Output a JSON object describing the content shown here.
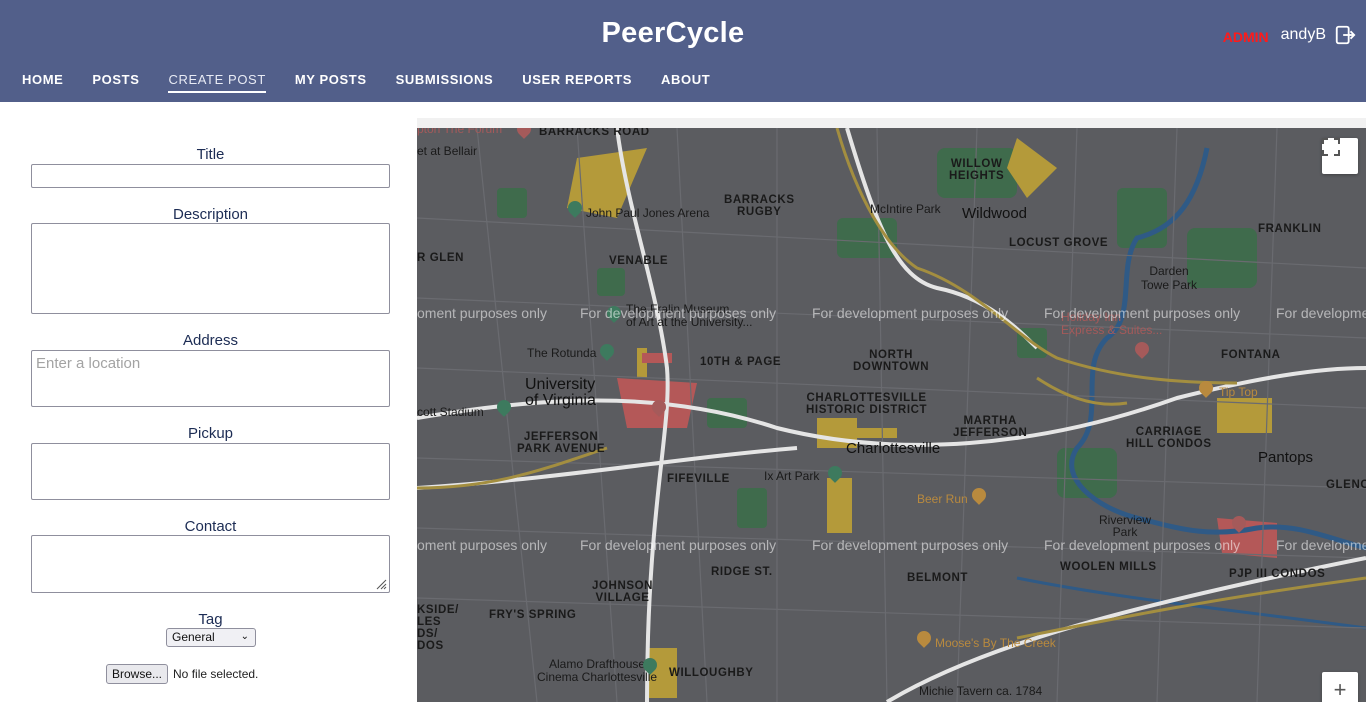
{
  "header": {
    "brand": "PeerCycle",
    "role_badge": "ADMIN",
    "username": "andyB",
    "logout_icon": "logout-icon",
    "bg_color": "#525f8a"
  },
  "nav": {
    "items": [
      {
        "label": "HOME",
        "active": false
      },
      {
        "label": "POSTS",
        "active": false
      },
      {
        "label": "CREATE POST",
        "active": true
      },
      {
        "label": "MY POSTS",
        "active": false
      },
      {
        "label": "SUBMISSIONS",
        "active": false
      },
      {
        "label": "USER REPORTS",
        "active": false
      },
      {
        "label": "ABOUT",
        "active": false
      }
    ]
  },
  "form": {
    "title_label": "Title",
    "title_value": "",
    "description_label": "Description",
    "description_value": "",
    "address_label": "Address",
    "address_placeholder": "Enter a location",
    "pickup_label": "Pickup",
    "pickup_value": "",
    "contact_label": "Contact",
    "contact_value": "",
    "tag_label": "Tag",
    "tag_selected": "General",
    "browse_label": "Browse...",
    "file_status": "No file selected."
  },
  "map": {
    "watermark": "For development purposes only",
    "watermark_left_cut": "oment purposes only",
    "watermark_right_cut": "For developme",
    "fullscreen_icon": "fullscreen-icon",
    "zoom_in_label": "+",
    "neighborhoods": {
      "barracks_road": "BARRACKS ROAD",
      "willow_heights": "WILLOW\nHEIGHTS",
      "barracks_rugby": "BARRACKS\nRUGBY",
      "locust_grove": "LOCUST GROVE",
      "franklin": "FRANKLIN",
      "r_glen": "R GLEN",
      "venable": "VENABLE",
      "tenth_page": "10TH & PAGE",
      "north_downtown": "NORTH\nDOWNTOWN",
      "fontana": "FONTANA",
      "charlottesville_historic": "CHARLOTTESVILLE\nHISTORIC DISTRICT",
      "martha_jefferson": "MARTHA\nJEFFERSON",
      "carriage_hill": "CARRIAGE\nHILL CONDOS",
      "jefferson_park": "JEFFERSON\nPARK AVENUE",
      "fifeville": "FIFEVILLE",
      "ridge_st": "RIDGE ST.",
      "belmont": "BELMONT",
      "woolen_mills": "WOOLEN MILLS",
      "pjp_condos": "PJP III CONDOS",
      "johnson_village": "JOHNSON\nVILLAGE",
      "frys_spring": "FRY'S SPRING",
      "willoughby": "WILLOUGHBY",
      "kside": "KSIDE/\nLES\nDS/\nDOS",
      "glenc": "GLENC"
    },
    "places": {
      "wildwood": "Wildwood",
      "charlottesville": "Charlottesville",
      "pantops": "Pantops",
      "university": "University\nof Virginia",
      "jpj_arena": "John Paul Jones Arena",
      "mcintire_park": "McIntire Park",
      "darden_towe": "Darden\nTowe Park",
      "fralin": "The Fralin Museum\nof Art at the University...",
      "rotunda": "The Rotunda",
      "stadium": "cott Stadium",
      "ix_art_park": "Ix Art Park",
      "beer_run": "Beer Run",
      "tip_top": "Tip Top",
      "riverview": "Riverview\nPark",
      "holiday_inn": "Holiday Inn\nExpress & Suites...",
      "mooses": "Moose's By The Creek",
      "alamo": "Alamo Drafthouse\nCinema Charlottesville",
      "michie": "Michie Tavern ca. 1784",
      "forum": "pton The Forum",
      "bellair": "et at Bellair"
    }
  }
}
